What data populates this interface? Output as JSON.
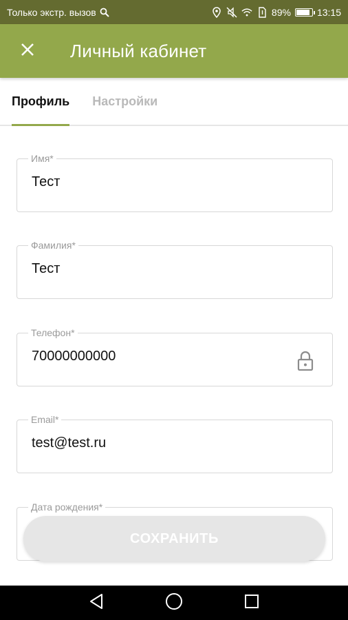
{
  "status_bar": {
    "carrier_text": "Только экстр. вызов",
    "battery_text": "89%",
    "battery_level": 0.89,
    "time": "13:15",
    "icons": [
      "search-icon",
      "location-icon",
      "mute-icon",
      "wifi-icon",
      "sim-icon",
      "battery-icon"
    ]
  },
  "app_bar": {
    "title": "Личный кабинет",
    "close_icon": "close-icon"
  },
  "tabs": [
    {
      "label": "Профиль",
      "active": true
    },
    {
      "label": "Настройки",
      "active": false
    }
  ],
  "form": {
    "first_name": {
      "label": "Имя*",
      "value": "Тест"
    },
    "last_name": {
      "label": "Фамилия*",
      "value": "Тест"
    },
    "phone": {
      "label": "Телефон*",
      "value": "70000000000",
      "icon": "lock-icon"
    },
    "email": {
      "label": "Email*",
      "value": "test@test.ru"
    },
    "birth_date": {
      "label": "Дата рождения*",
      "value": ""
    }
  },
  "save_button": {
    "label": "СОХРАНИТЬ"
  },
  "nav_bar": {
    "icons": [
      "back-icon",
      "home-icon",
      "recents-icon"
    ]
  },
  "colors": {
    "status_bar": "#646b30",
    "app_bar": "#93a84b",
    "accent": "#93a84b",
    "button_disabled": "#e6e6e6"
  }
}
